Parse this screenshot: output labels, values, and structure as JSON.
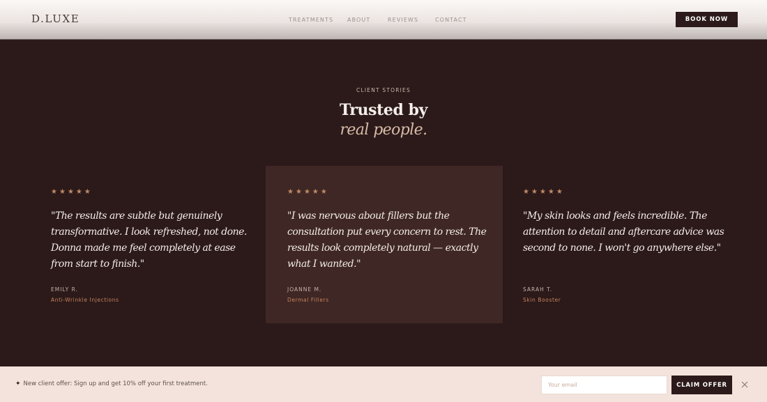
{
  "header": {
    "logo": "D.LUXE",
    "nav": [
      "TREATMENTS",
      "ABOUT",
      "REVIEWS",
      "CONTACT"
    ],
    "book_label": "BOOK NOW"
  },
  "section": {
    "kicker": "CLIENT STORIES",
    "title_line1": "Trusted by",
    "title_line2": "real people."
  },
  "reviews": [
    {
      "rating": 5,
      "quote": "\"The results are subtle but genuinely transformative. I look refreshed, not done. Donna made me feel completely at ease from start to finish.\"",
      "author": "EMILY R.",
      "treatment": "Anti-Wrinkle Injections"
    },
    {
      "rating": 5,
      "quote": "\"I was nervous about fillers but the consultation put every concern to rest. The results look completely natural — exactly what I wanted.\"",
      "author": "JOANNE M.",
      "treatment": "Dermal Fillers"
    },
    {
      "rating": 5,
      "quote": "\"My skin looks and feels incredible. The attention to detail and aftercare advice was second to none. I won't go anywhere else.\"",
      "author": "SARAH T.",
      "treatment": "Skin Booster"
    }
  ],
  "offer": {
    "icon": "sparkle-icon",
    "text": "New client offer: Sign up and get 10% off your first treatment.",
    "email_placeholder": "Your email",
    "email_value": "",
    "claim_label": "CLAIM OFFER"
  },
  "colors": {
    "background": "#2c1a1a",
    "card_highlight": "#3f2725",
    "accent": "#c6825c",
    "offer_bar": "#f3e3dc"
  }
}
